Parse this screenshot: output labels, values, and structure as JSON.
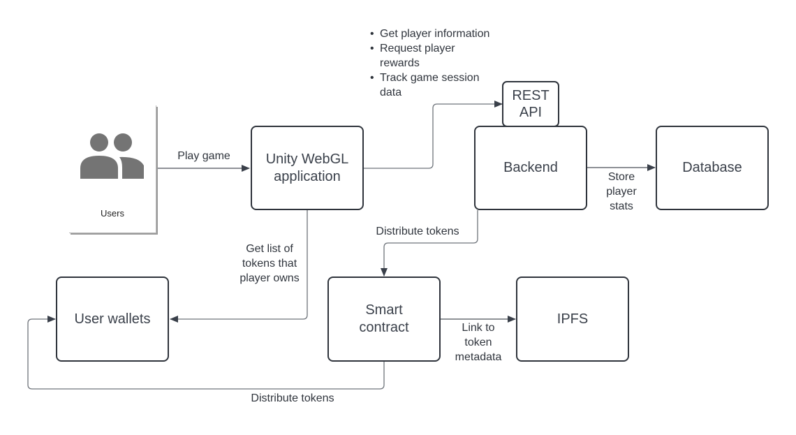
{
  "diagram": {
    "actor": {
      "label": "Users",
      "icon": "users-icon"
    },
    "nodes": {
      "unity": "Unity WebGL application",
      "unity_line1": "Unity WebGL",
      "unity_line2": "application",
      "rest_api_line1": "REST",
      "rest_api_line2": "API",
      "backend": "Backend",
      "database": "Database",
      "user_wallets": "User wallets",
      "smart_contract_line1": "Smart",
      "smart_contract_line2": "contract",
      "ipfs": "IPFS"
    },
    "edges": {
      "play_game": "Play game",
      "store_player_stats": [
        "Store",
        "player",
        "stats"
      ],
      "distribute_tokens_backend": "Distribute tokens",
      "get_tokens": [
        "Get list of",
        "tokens that",
        "player owns"
      ],
      "link_metadata": [
        "Link to",
        "token",
        "metadata"
      ],
      "distribute_tokens_wallets": "Distribute tokens"
    },
    "api_notes": [
      "Get player information",
      "Request player rewards",
      "Track game session data"
    ]
  },
  "colors": {
    "node_border": "#2e333b",
    "edge": "#6e737a",
    "arrowhead": "#3a404a",
    "text": "#333a45",
    "actor_icon": "#747474"
  }
}
